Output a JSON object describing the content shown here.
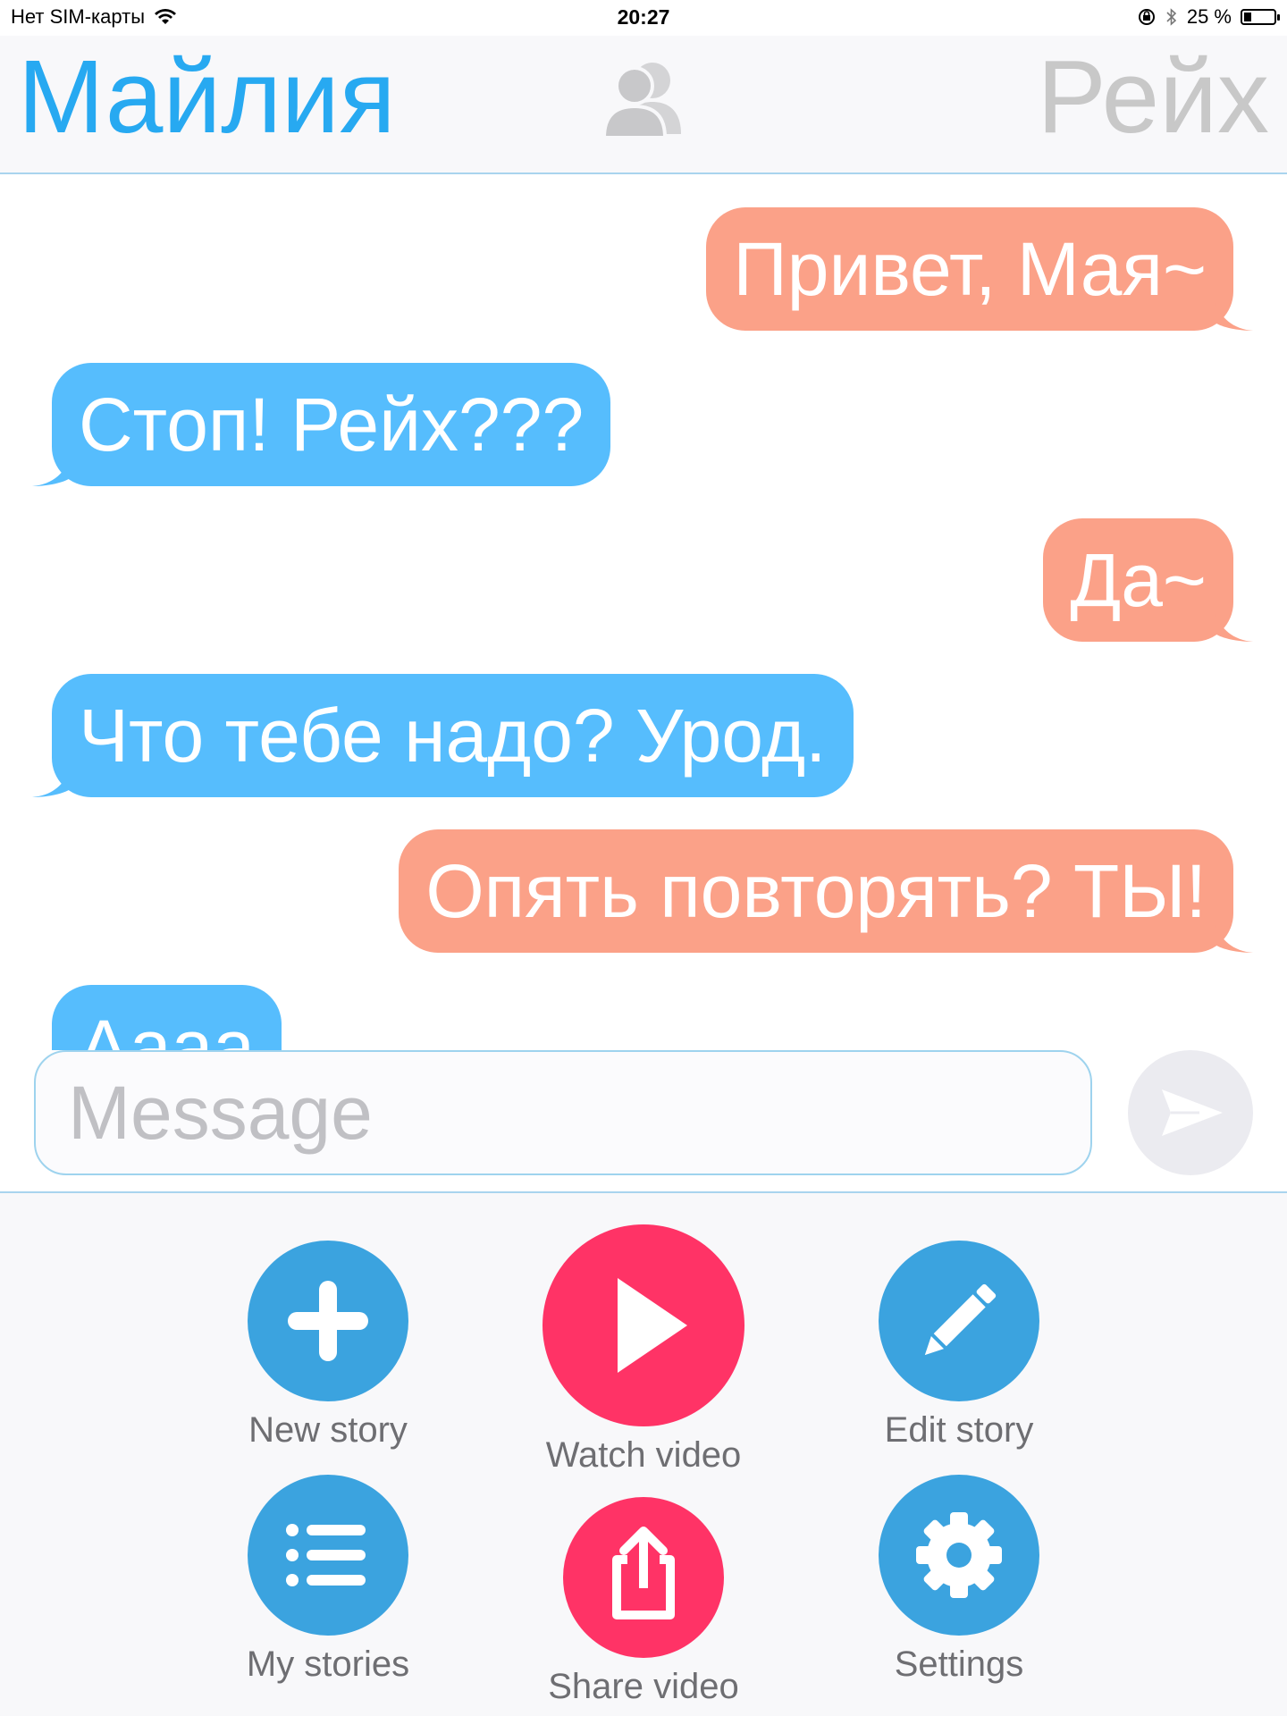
{
  "status_bar": {
    "carrier": "Нет SIM-карты",
    "time": "20:27",
    "battery_text": "25 %",
    "battery_level": 0.25
  },
  "header": {
    "left_name": "Майлия",
    "right_name": "Рейх",
    "center_icon": "people-icon"
  },
  "messages": [
    {
      "side": "out",
      "text": "Привет, Мая~"
    },
    {
      "side": "in",
      "text": "Стоп! Рейх???"
    },
    {
      "side": "out",
      "text": "Да~"
    },
    {
      "side": "in",
      "text": "Что тебе надо? Урод."
    },
    {
      "side": "out",
      "text": "Опять повторять? ТЫ!"
    },
    {
      "side": "in",
      "text": "Аааа"
    }
  ],
  "composer": {
    "placeholder": "Message",
    "send_icon": "send-icon"
  },
  "actions": {
    "new_story": "New story",
    "watch_video": "Watch video",
    "edit_story": "Edit story",
    "my_stories": "My stories",
    "share_video": "Share video",
    "settings": "Settings"
  },
  "colors": {
    "accent_blue": "#27a9f1",
    "bubble_out": "#fba188",
    "bubble_in": "#56bdfd",
    "action_blue": "#3ba3df",
    "action_pink": "#ff3366"
  }
}
